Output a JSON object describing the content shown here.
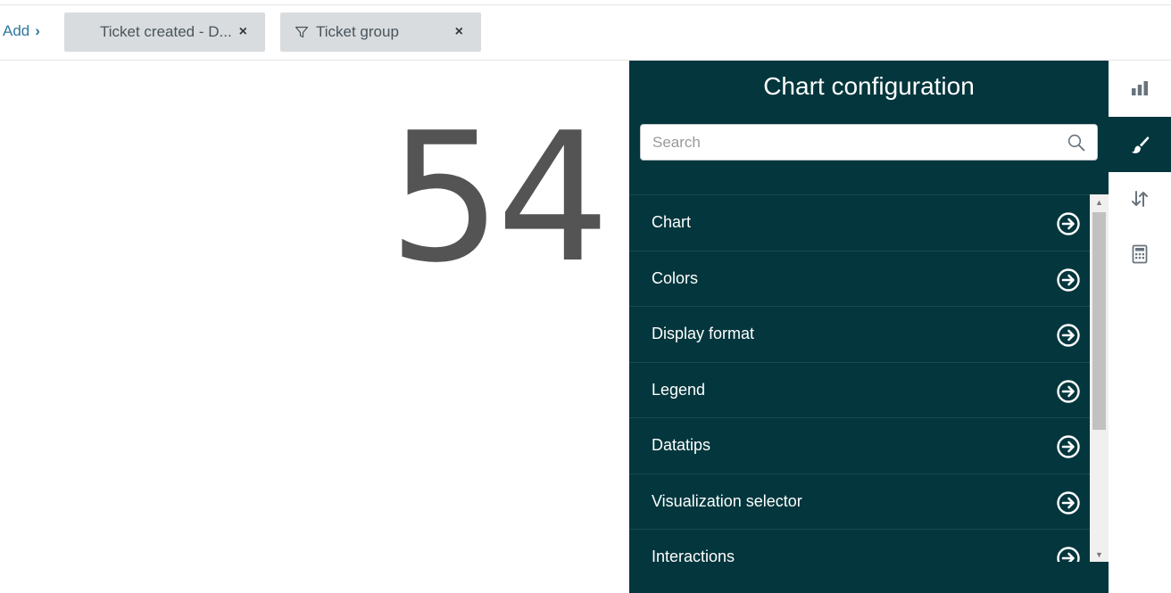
{
  "filter_bar": {
    "add_label": "Add",
    "add_chevron": "›",
    "chips": [
      {
        "label": "Ticket created - D...",
        "icon": "funnel-icon",
        "has_funnel": false,
        "close": "×"
      },
      {
        "label": "Ticket group",
        "icon": "funnel-icon",
        "has_funnel": true,
        "close": "×"
      }
    ]
  },
  "metric": {
    "value": "54"
  },
  "config_panel": {
    "title": "Chart configuration",
    "search": {
      "placeholder": "Search",
      "value": ""
    },
    "items": [
      {
        "label": "Chart"
      },
      {
        "label": "Colors"
      },
      {
        "label": "Display format"
      },
      {
        "label": "Legend"
      },
      {
        "label": "Datatips"
      },
      {
        "label": "Visualization selector"
      },
      {
        "label": "Interactions"
      }
    ],
    "scroll_position": 0
  },
  "side_toolbar": {
    "buttons": [
      {
        "icon": "bar-chart-icon",
        "active": false
      },
      {
        "icon": "paintbrush-icon",
        "active": true
      },
      {
        "icon": "sort-arrows-icon",
        "active": false
      },
      {
        "icon": "calculator-icon",
        "active": false
      }
    ]
  },
  "colors": {
    "panel_bg": "#03363d",
    "chip_bg": "#d9dcde",
    "link": "#30769e",
    "metric_text": "#545454",
    "icon_gray": "#68737d"
  }
}
